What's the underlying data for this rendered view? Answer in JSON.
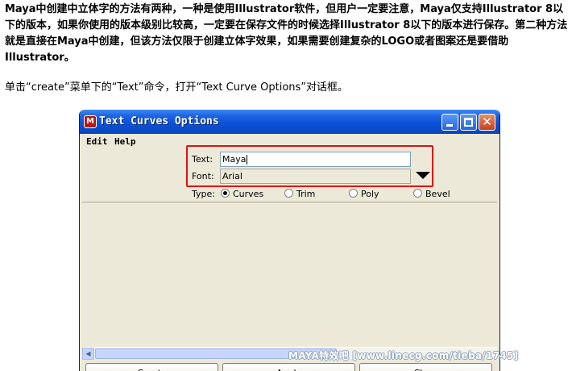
{
  "article": {
    "paragraph_bold": "Maya中创建中立体字的方法有两种，一种是使用Illustrator软件，但用户一定要注意，Maya仅支持Illustrator 8以下的版本，如果你使用的版本级别比较高，一定要在保存文件的时候选择Illustrator 8以下的版本进行保存。第二种方法就是直接在Maya中创建，但该方法仅限于创建立体字效果，如果需要创建复杂的LOGO或者图案还是要借助Illustrator。",
    "paragraph_plain": "单击“create”菜单下的“Text”命令，打开“Text Curve Options”对话框。"
  },
  "window": {
    "title": "Text Curves Options",
    "app_icon": "maya-icon",
    "controls": [
      "minimize-icon",
      "maximize-icon",
      "close-icon"
    ]
  },
  "menubar": {
    "items": [
      "Edit",
      "Help"
    ]
  },
  "form": {
    "text_label": "Text:",
    "text_value": "Maya",
    "font_label": "Font:",
    "font_value": "Arial",
    "font_dropdown_icon": "triangle-down-icon",
    "type_label": "Type:",
    "type_options": [
      {
        "label": "Curves",
        "selected": true
      },
      {
        "label": "Trim",
        "selected": false
      },
      {
        "label": "Poly",
        "selected": false
      },
      {
        "label": "Bevel",
        "selected": false
      }
    ],
    "highlight_color": "#e01010"
  },
  "buttons": {
    "create": "Create",
    "apply": "Apply",
    "close": "Close"
  },
  "watermark": "MAYA特效吧 [www.linecg.com/tieba/1745]",
  "colors": {
    "titlebar": "#0a50d6",
    "dialog_bg": "#ece9d8"
  }
}
